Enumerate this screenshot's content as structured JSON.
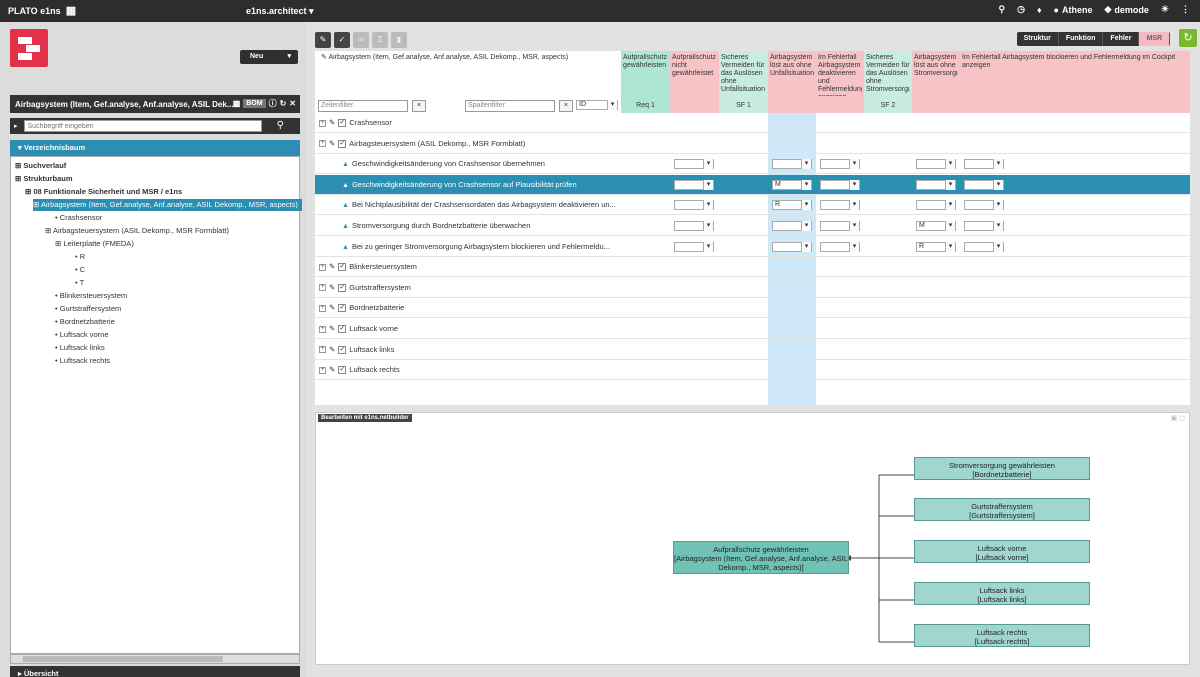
{
  "topbar": {
    "brand": "PLATO e1ns",
    "app_title": "e1ns.architect ▾",
    "user": "Athene",
    "workspace": "demode"
  },
  "left": {
    "new_button": "Neu",
    "context_title": "Airbagsystem (Item, Gef.analyse, Anf.analyse, ASIL Dek...",
    "bom_label": "BOM",
    "search_placeholder": "Suchbegriff eingeben",
    "tree_header": "Verzeichnisbaum",
    "tree": [
      {
        "label": "Suchverlauf",
        "bold": true
      },
      {
        "label": "Strukturbaum",
        "bold": true
      },
      {
        "label": "08 Funktionale Sicherheit und MSR / e1ns",
        "bold": true
      },
      {
        "label": "Airbagsystem (Item, Gef.analyse, Anf.analyse, ASIL Dekomp., MSR, aspects)",
        "selected": true
      },
      {
        "label": "Crashsensor"
      },
      {
        "label": "Airbagsteuersystem (ASIL Dekomp., MSR Formblatt)"
      },
      {
        "label": "Leiterplatte (FMEDA)"
      },
      {
        "label": "R"
      },
      {
        "label": "C"
      },
      {
        "label": "T"
      },
      {
        "label": "Blinkersteuersystem"
      },
      {
        "label": "Gurtstraffersystem"
      },
      {
        "label": "Bordnetzbatterie"
      },
      {
        "label": "Luftsack vorne"
      },
      {
        "label": "Luftsack links"
      },
      {
        "label": "Luftsack rechts"
      }
    ],
    "overview": "Übersicht"
  },
  "toolbar": {
    "views": [
      "Struktur",
      "Funktion",
      "Fehler",
      "MSR"
    ],
    "active_view": "MSR"
  },
  "grid": {
    "root_label": "Airbagsystem (Item, Gef.analyse, Anf.analyse, ASIL Dekomp., MSR, aspects)",
    "row_filter": "Zeilenfilter",
    "col_filter": "Spaltenfilter",
    "id_select": "ID",
    "columns": [
      {
        "title": "Aufprallschutz gewährleisten",
        "sub": "Req 1",
        "color": "#aee6d6"
      },
      {
        "title": "Aufprallschutz nicht gewährleistet",
        "sub": "",
        "color": "#f6c4c6"
      },
      {
        "title": "Sicheres Vermeiden für das Auslösen ohne Unfallsituation",
        "sub": "SF 1",
        "color": "#c8ecdd"
      },
      {
        "title": "Airbagsystem löst aus ohne Unfallsituation",
        "sub": "",
        "color": "#f6c4c6"
      },
      {
        "title": "Im Fehlerfall Airbagsystem deaktivieren und Fehlermeldung anzeigen",
        "sub": "",
        "color": "#f6c4c6"
      },
      {
        "title": "Sicheres Vermeiden für das Auslösen ohne Stromversorgung",
        "sub": "SF 2",
        "color": "#c8ecdd"
      },
      {
        "title": "Airbagsystem löst aus ohne Stromversorgung",
        "sub": "",
        "color": "#f6c4c6"
      },
      {
        "title": "Im Fehlerfall Airbagsystem blockieren und Fehlermeldung im Cockpit anzeigen",
        "sub": "",
        "color": "#f6c4c6"
      }
    ],
    "rows": [
      {
        "label": "Crashsensor",
        "type": "item"
      },
      {
        "label": "Airbagsteuersystem (ASIL Dekomp., MSR Formblatt)",
        "type": "item"
      },
      {
        "label": "Geschwindigkeitsänderung von Crashsensor übernehmen",
        "type": "func",
        "vals": [
          "",
          "",
          "",
          ""
        ]
      },
      {
        "label": "Geschwindigkeitsänderung von Crashsensor auf Plausibilität prüfen",
        "type": "func",
        "selected": true,
        "vals": [
          "",
          "M",
          "",
          ""
        ]
      },
      {
        "label": "Bei Nichtplausibilität der Crashsensordaten das Airbagsystem deaktivieren un...",
        "type": "func",
        "vals": [
          "",
          "R",
          "",
          ""
        ]
      },
      {
        "label": "Stromversorgung durch Bordnetzbatterie überwachen",
        "type": "func",
        "vals": [
          "",
          "",
          "M",
          ""
        ]
      },
      {
        "label": "Bei zu geringer Stromversorgung Airbagsystem blockieren und Fehlermeldu...",
        "type": "func",
        "vals": [
          "",
          "",
          "R",
          ""
        ]
      },
      {
        "label": "Blinkersteuersystem",
        "type": "item"
      },
      {
        "label": "Gurtstraffersystem",
        "type": "item"
      },
      {
        "label": "Bordnetzbatterie",
        "type": "item"
      },
      {
        "label": "Luftsack vorne",
        "type": "item"
      },
      {
        "label": "Luftsack links",
        "type": "item"
      },
      {
        "label": "Luftsack rechts",
        "type": "item"
      }
    ]
  },
  "editor": {
    "tab": "Bearbeiten mit e1ns.netbuilder",
    "main_node": "Aufprallschutz gewährleisten\n[Airbagsystem (Item, Gef.analyse, Anf.analyse, ASIL Dekomp., MSR, aspects)]",
    "nodes": [
      "Stromversorgung gewährleisten\n[Bordnetzbatterie]",
      "Gurtstraffersystem\n[Gurtstraffersystem]",
      "Luftsack vorne\n[Luftsack vorne]",
      "Luftsack links\n[Luftsack links]",
      "Luftsack rechts\n[Luftsack rechts]"
    ]
  }
}
